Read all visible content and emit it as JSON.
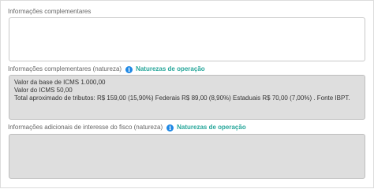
{
  "field1": {
    "label": "Informações complementares",
    "value": ""
  },
  "field2": {
    "label": "Informações complementares (natureza)",
    "link": "Naturezas de operação",
    "lines": [
      "Valor da base de ICMS 1.000,00",
      "Valor do ICMS 50,00",
      "Total aproximado de tributos: R$ 159,00 (15,90%)  Federais R$ 89,00 (8,90%)  Estaduais R$ 70,00 (7,00%) . Fonte IBPT."
    ]
  },
  "field3": {
    "label": "Informações adicionais de interesse do fisco (natureza)",
    "link": "Naturezas de operação",
    "value": ""
  },
  "colors": {
    "info_icon": "#1e88e5",
    "link": "#26a69a",
    "readonly_bg": "#dedede"
  },
  "icons": {
    "info": "info-icon"
  }
}
